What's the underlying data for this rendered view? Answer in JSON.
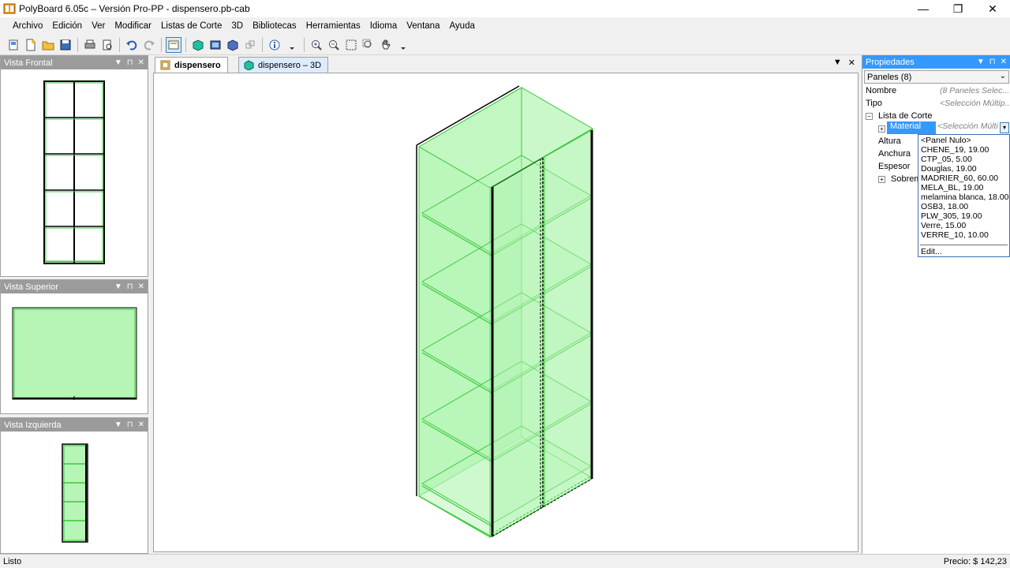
{
  "window": {
    "title": "PolyBoard 6.05c – Versión Pro-PP - dispensero.pb-cab",
    "minimize": "—",
    "restore": "❐",
    "close": "✕"
  },
  "menu": [
    "Archivo",
    "Edición",
    "Ver",
    "Modificar",
    "Listas de Corte",
    "3D",
    "Bibliotecas",
    "Herramientas",
    "Idioma",
    "Ventana",
    "Ayuda"
  ],
  "panels": {
    "front": {
      "title": "Vista Frontal"
    },
    "top": {
      "title": "Vista Superior"
    },
    "left": {
      "title": "Vista Izquierda"
    },
    "header_icons": {
      "dropdown": "▼",
      "pin": "⊓",
      "close": "✕"
    }
  },
  "doc_tabs": [
    {
      "label": "dispensero",
      "active": true
    },
    {
      "label": "dispensero – 3D",
      "active": false
    }
  ],
  "doc_tab_controls": {
    "dropdown": "▼",
    "close": "✕"
  },
  "properties": {
    "title": "Propiedades",
    "selector": "Paneles (8)",
    "selector_arrow": "⌄",
    "rows": {
      "nombre": {
        "label": "Nombre",
        "value": "(8 Paneles Selec..."
      },
      "tipo": {
        "label": "Tipo",
        "value": "<Selección Múltip..."
      },
      "lista_corte": {
        "label": "Lista de Corte"
      },
      "material": {
        "label": "Material",
        "value": "<Selección Múlti"
      },
      "altura": {
        "label": "Altura"
      },
      "anchura": {
        "label": "Anchura"
      },
      "espesor": {
        "label": "Espesor"
      },
      "sobrem": {
        "label": "Sobrem"
      }
    },
    "expander_minus": "−",
    "expander_plus": "+",
    "dropdown_button": "▾"
  },
  "material_options": [
    "<Panel Nulo>",
    "CHENE_19, 19.00",
    "CTP_05, 5.00",
    "Douglas, 19.00",
    "MADRIER_60, 60.00",
    "MELA_BL, 19.00",
    "melamina blanca, 18.00",
    "OSB3, 18.00",
    "PLW_305, 19.00",
    "Verre, 15.00",
    "VERRE_10, 10.00"
  ],
  "material_edit": "Edit...",
  "status": {
    "left": "Listo",
    "right": "Precio: $ 142,23"
  },
  "colors": {
    "panel_green": "#b6f5b6",
    "edge_green": "#3cc83c",
    "accent_blue": "#3399ff",
    "panel_header_grey": "#9b9b9b"
  }
}
